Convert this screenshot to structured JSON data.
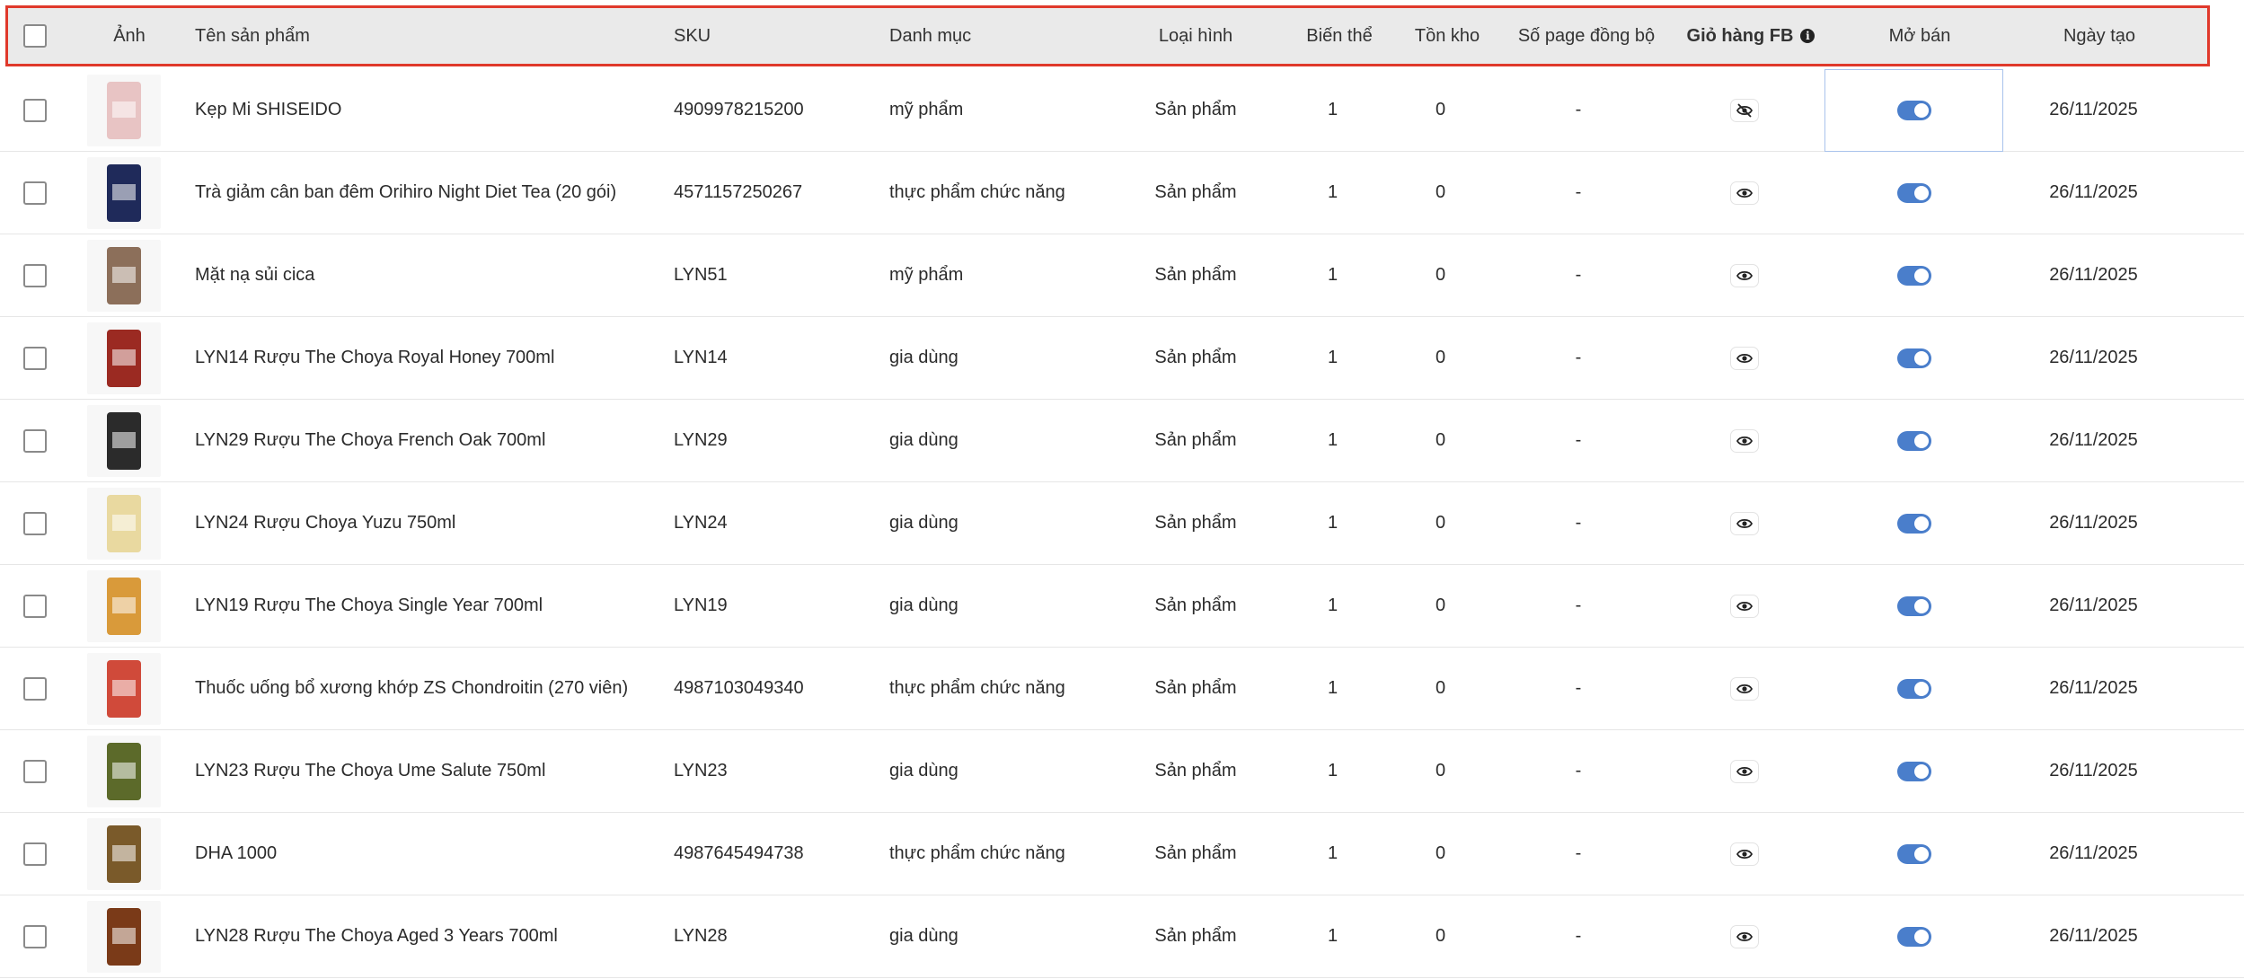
{
  "header": {
    "image": "Ảnh",
    "name": "Tên sản phẩm",
    "sku": "SKU",
    "category": "Danh mục",
    "type": "Loại hình",
    "variants": "Biến thể",
    "stock": "Tồn kho",
    "synced_pages": "Số page đồng bộ",
    "fb_cart": "Giỏ hàng FB",
    "on_sale": "Mở bán",
    "created": "Ngày tạo"
  },
  "rows": [
    {
      "name": "Kẹp Mi SHISEIDO",
      "sku": "4909978215200",
      "category": "mỹ phẩm",
      "type": "Sản phẩm",
      "variants": "1",
      "stock": "0",
      "pages": "-",
      "fb_visible": false,
      "on_sale": true,
      "created": "26/11/2025",
      "thumb": "#e8c4c4"
    },
    {
      "name": "Trà giảm cân ban đêm Orihiro Night Diet Tea (20 gói)",
      "sku": "4571157250267",
      "category": "thực phẩm chức năng",
      "type": "Sản phẩm",
      "variants": "1",
      "stock": "0",
      "pages": "-",
      "fb_visible": true,
      "on_sale": true,
      "created": "26/11/2025",
      "thumb": "#1f2a5a"
    },
    {
      "name": "Mặt nạ sủi cica",
      "sku": "LYN51",
      "category": "mỹ phẩm",
      "type": "Sản phẩm",
      "variants": "1",
      "stock": "0",
      "pages": "-",
      "fb_visible": true,
      "on_sale": true,
      "created": "26/11/2025",
      "thumb": "#8c6f5a"
    },
    {
      "name": "LYN14 Rượu The Choya Royal Honey 700ml",
      "sku": "LYN14",
      "category": "gia dùng",
      "type": "Sản phẩm",
      "variants": "1",
      "stock": "0",
      "pages": "-",
      "fb_visible": true,
      "on_sale": true,
      "created": "26/11/2025",
      "thumb": "#9b2a22"
    },
    {
      "name": "LYN29 Rượu The Choya French Oak 700ml",
      "sku": "LYN29",
      "category": "gia dùng",
      "type": "Sản phẩm",
      "variants": "1",
      "stock": "0",
      "pages": "-",
      "fb_visible": true,
      "on_sale": true,
      "created": "26/11/2025",
      "thumb": "#2b2b2b"
    },
    {
      "name": "LYN24 Rượu Choya Yuzu 750ml",
      "sku": "LYN24",
      "category": "gia dùng",
      "type": "Sản phẩm",
      "variants": "1",
      "stock": "0",
      "pages": "-",
      "fb_visible": true,
      "on_sale": true,
      "created": "26/11/2025",
      "thumb": "#e9d9a0"
    },
    {
      "name": "LYN19 Rượu The Choya Single Year 700ml",
      "sku": "LYN19",
      "category": "gia dùng",
      "type": "Sản phẩm",
      "variants": "1",
      "stock": "0",
      "pages": "-",
      "fb_visible": true,
      "on_sale": true,
      "created": "26/11/2025",
      "thumb": "#d99a3a"
    },
    {
      "name": "Thuốc uống bổ xương khớp ZS Chondroitin (270 viên)",
      "sku": "4987103049340",
      "category": "thực phẩm chức năng",
      "type": "Sản phẩm",
      "variants": "1",
      "stock": "0",
      "pages": "-",
      "fb_visible": true,
      "on_sale": true,
      "created": "26/11/2025",
      "thumb": "#d04a3a"
    },
    {
      "name": "LYN23 Rượu The Choya Ume Salute 750ml",
      "sku": "LYN23",
      "category": "gia dùng",
      "type": "Sản phẩm",
      "variants": "1",
      "stock": "0",
      "pages": "-",
      "fb_visible": true,
      "on_sale": true,
      "created": "26/11/2025",
      "thumb": "#5c6a2a"
    },
    {
      "name": "DHA 1000",
      "sku": "4987645494738",
      "category": "thực phẩm chức năng",
      "type": "Sản phẩm",
      "variants": "1",
      "stock": "0",
      "pages": "-",
      "fb_visible": true,
      "on_sale": true,
      "created": "26/11/2025",
      "thumb": "#7a5a2a"
    },
    {
      "name": "LYN28 Rượu The Choya Aged 3 Years 700ml",
      "sku": "LYN28",
      "category": "gia dùng",
      "type": "Sản phẩm",
      "variants": "1",
      "stock": "0",
      "pages": "-",
      "fb_visible": true,
      "on_sale": true,
      "created": "26/11/2025",
      "thumb": "#7a3a18"
    }
  ]
}
